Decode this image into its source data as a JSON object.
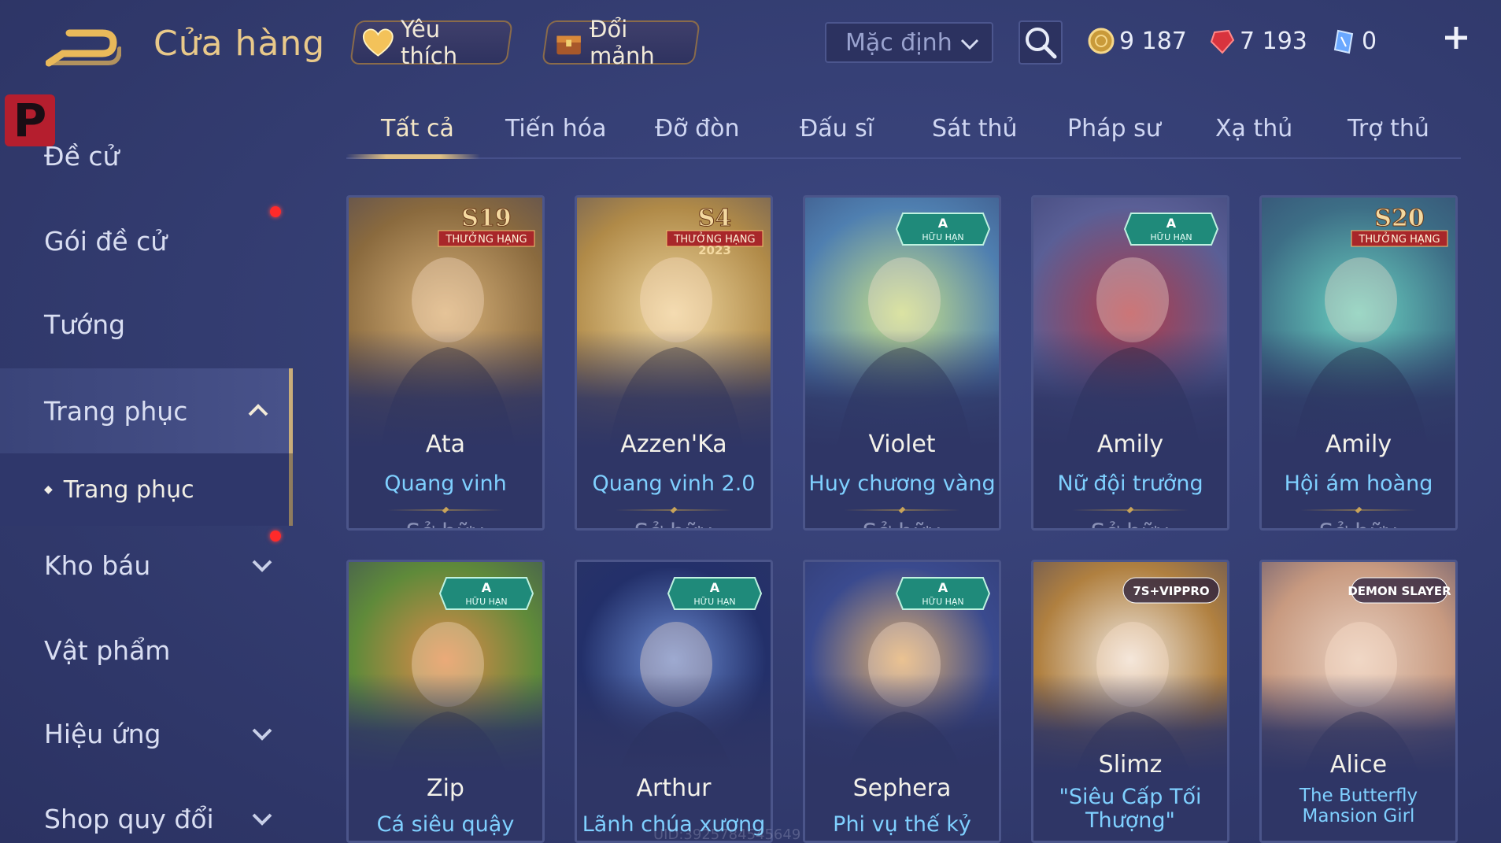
{
  "header": {
    "title": "Cửa hàng",
    "favorite_label": "Yêu thích",
    "exchange_label": "Đổi mảnh",
    "sort_value": "Mặc định",
    "currencies": [
      {
        "icon": "gold-coin-icon",
        "value": "9 187"
      },
      {
        "icon": "ruby-icon",
        "value": "7 193"
      },
      {
        "icon": "voucher-gem-icon",
        "value": "0"
      }
    ]
  },
  "sidebar": {
    "items": [
      {
        "label": "Đề cử"
      },
      {
        "label": "Gói đề cử"
      },
      {
        "label": "Tướng"
      },
      {
        "label": "Trang phục"
      },
      {
        "label": "Trang phục"
      },
      {
        "label": "Kho báu"
      },
      {
        "label": "Vật phẩm"
      },
      {
        "label": "Hiệu ứng"
      },
      {
        "label": "Shop quy đổi"
      }
    ]
  },
  "tabs": [
    "Tất cả",
    "Tiến hóa",
    "Đỡ đòn",
    "Đấu sĩ",
    "Sát thủ",
    "Pháp sư",
    "Xạ thủ",
    "Trợ thủ"
  ],
  "cards": [
    {
      "hero": "Ata",
      "skin": "Quang vinh",
      "status": "Sở hữu",
      "tag": "S19",
      "tag_sub": "THƯỞNG HẠNG",
      "colors": [
        "#8a6a3e",
        "#d8b27a"
      ]
    },
    {
      "hero": "Azzen'Ka",
      "skin": "Quang vinh 2.0",
      "status": "Sở hữu",
      "tag": "S4",
      "tag_sub": "THƯỞNG HẠNG",
      "tag_year": "2023",
      "colors": [
        "#b08a48",
        "#efd7a0"
      ]
    },
    {
      "hero": "Violet",
      "skin": "Huy chương vàng",
      "status": "Sở hữu",
      "tag": "A",
      "tag_sub": "HỮU HẠN",
      "colors": [
        "#4f7fb0",
        "#c8e28a"
      ]
    },
    {
      "hero": "Amily",
      "skin": "Nữ đội trưởng",
      "status": "Sở hữu",
      "tag": "A",
      "tag_sub": "HỮU HẠN",
      "colors": [
        "#5a5f96",
        "#b03a48"
      ]
    },
    {
      "hero": "Amily",
      "skin": "Hội ám hoàng",
      "status": "Sở hữu",
      "tag": "S20",
      "tag_sub": "THƯỞNG HẠNG",
      "colors": [
        "#3d6e86",
        "#6ad0c0"
      ]
    },
    {
      "hero": "Zip",
      "skin": "Cá siêu quậy",
      "status": "",
      "tag": "A",
      "tag_sub": "HỮU HẠN",
      "colors": [
        "#5f8a3a",
        "#e08a4a"
      ]
    },
    {
      "hero": "Arthur",
      "skin": "Lãnh chúa xương",
      "status": "",
      "tag": "A",
      "tag_sub": "HỮU HẠN",
      "colors": [
        "#23306a",
        "#6a8ad0"
      ]
    },
    {
      "hero": "Sephera",
      "skin": "Phi vụ thế kỷ",
      "status": "",
      "tag": "A",
      "tag_sub": "HỮU HẠN",
      "colors": [
        "#3a4a8e",
        "#e0b070"
      ]
    },
    {
      "hero": "Slimz",
      "skin": "\"Siêu Cấp Tối Thượng\"",
      "status": "",
      "tag": "7S+VIPPRO",
      "tag_sub": "",
      "colors": [
        "#b08040",
        "#f0e8e0"
      ]
    },
    {
      "hero": "Alice",
      "skin": "The Butterfly Mansion Girl",
      "status": "",
      "tag": "DEMON SLAYER",
      "tag_sub": "",
      "colors": [
        "#c89a80",
        "#e8d0c0"
      ]
    }
  ],
  "uid_text": "UID:3925784545649"
}
